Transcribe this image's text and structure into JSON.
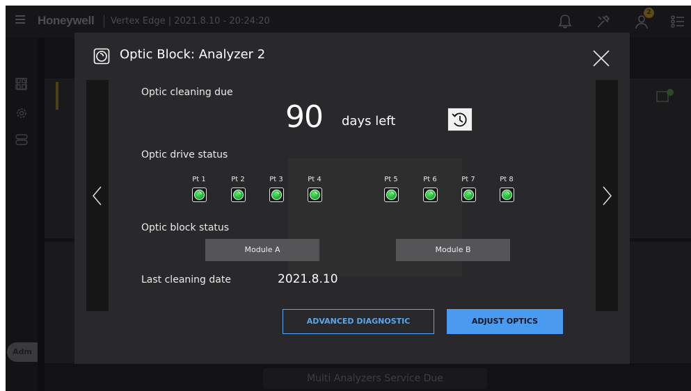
{
  "app": {
    "brand": "Honeywell",
    "title": "Vertex Edge | 2021.8.10 - 20:24:20",
    "user_badge_count": "2",
    "avatar": "Adm",
    "footer_banner": "Multi Analyzers Service Due"
  },
  "icons": {
    "menu": "hamburger-icon",
    "notifications": "bell-icon",
    "service": "tools-icon",
    "user": "user-icon",
    "list": "list-icon",
    "optic": "optic-block-icon",
    "close": "close-icon",
    "reset": "history-icon"
  },
  "modal": {
    "title": "Optic Block: Analyzer 2",
    "cleaning_label": "Optic cleaning due",
    "days_value": "90",
    "days_unit": "days left",
    "drive_label": "Optic drive status",
    "points": [
      {
        "label": "Pt 1",
        "status": "ok"
      },
      {
        "label": "Pt 2",
        "status": "ok"
      },
      {
        "label": "Pt 3",
        "status": "ok"
      },
      {
        "label": "Pt 4",
        "status": "ok"
      },
      {
        "label": "Pt 5",
        "status": "ok"
      },
      {
        "label": "Pt 6",
        "status": "ok"
      },
      {
        "label": "Pt 7",
        "status": "ok"
      },
      {
        "label": "Pt 8",
        "status": "ok"
      }
    ],
    "block_label": "Optic block status",
    "module_a": "Module A",
    "module_b": "Module B",
    "last_label": "Last cleaning date",
    "last_value": "2021.8.10",
    "advanced_button": "ADVANCED DIAGNOSTIC",
    "adjust_button": "ADJUST OPTICS"
  },
  "colors": {
    "accent": "#4a9af0",
    "status_ok": "#22c03a",
    "modal_bg": "#29292b"
  }
}
